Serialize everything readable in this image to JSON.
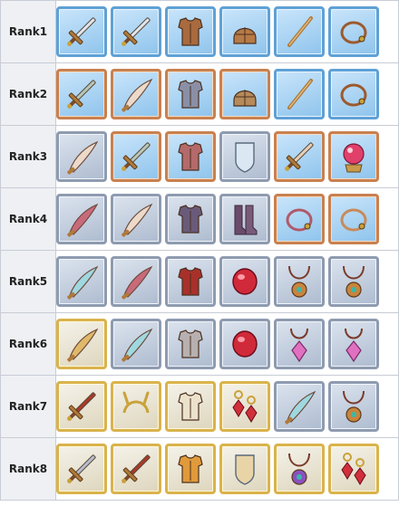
{
  "colors": {
    "blue": "#5fa1d6",
    "copper": "#c88150",
    "silver": "#8e9bb0",
    "gold": "#d9b34c"
  },
  "ranks": [
    {
      "label": "Rank1",
      "items": [
        {
          "icon": "longsword-icon",
          "frame": "blue"
        },
        {
          "icon": "longsword-icon",
          "frame": "blue"
        },
        {
          "icon": "leather-armor-icon",
          "frame": "blue"
        },
        {
          "icon": "leather-cap-icon",
          "frame": "blue"
        },
        {
          "icon": "wand-icon",
          "frame": "blue"
        },
        {
          "icon": "cord-bracelet-icon",
          "frame": "blue"
        }
      ]
    },
    {
      "label": "Rank2",
      "items": [
        {
          "icon": "spiked-sword-icon",
          "frame": "copper"
        },
        {
          "icon": "curved-blade-icon",
          "frame": "copper"
        },
        {
          "icon": "chest-armor-icon",
          "frame": "copper"
        },
        {
          "icon": "plumed-helmet-icon",
          "frame": "copper"
        },
        {
          "icon": "wand-icon",
          "frame": "blue"
        },
        {
          "icon": "cord-bracelet-icon",
          "frame": "blue"
        }
      ]
    },
    {
      "label": "Rank3",
      "items": [
        {
          "icon": "curved-blade-icon",
          "frame": "silver"
        },
        {
          "icon": "spiked-sword-icon",
          "frame": "copper"
        },
        {
          "icon": "plate-armor-icon",
          "frame": "copper"
        },
        {
          "icon": "crystal-shield-icon",
          "frame": "silver"
        },
        {
          "icon": "jeweled-dagger-icon",
          "frame": "copper"
        },
        {
          "icon": "crystal-orb-icon",
          "frame": "copper"
        }
      ]
    },
    {
      "label": "Rank4",
      "items": [
        {
          "icon": "winged-blade-icon",
          "frame": "silver"
        },
        {
          "icon": "curved-blade-icon",
          "frame": "silver"
        },
        {
          "icon": "dark-armor-icon",
          "frame": "silver"
        },
        {
          "icon": "boots-icon",
          "frame": "silver"
        },
        {
          "icon": "gem-bracelet-icon",
          "frame": "copper"
        },
        {
          "icon": "bead-bracelet-icon",
          "frame": "copper"
        }
      ]
    },
    {
      "label": "Rank5",
      "items": [
        {
          "icon": "teal-blade-icon",
          "frame": "silver"
        },
        {
          "icon": "winged-blade-icon",
          "frame": "silver"
        },
        {
          "icon": "caped-armor-icon",
          "frame": "silver"
        },
        {
          "icon": "ruby-gem-icon",
          "frame": "silver"
        },
        {
          "icon": "pendant-icon",
          "frame": "silver"
        },
        {
          "icon": "pendant-icon",
          "frame": "silver"
        }
      ]
    },
    {
      "label": "Rank6",
      "items": [
        {
          "icon": "golden-blade-icon",
          "frame": "gold"
        },
        {
          "icon": "teal-blade-icon",
          "frame": "silver"
        },
        {
          "icon": "steel-armor-icon",
          "frame": "silver"
        },
        {
          "icon": "ruby-gem-icon",
          "frame": "silver"
        },
        {
          "icon": "crystal-pendant-icon",
          "frame": "silver"
        },
        {
          "icon": "crystal-pendant-icon",
          "frame": "silver"
        }
      ]
    },
    {
      "label": "Rank7",
      "items": [
        {
          "icon": "crimson-sword-icon",
          "frame": "gold"
        },
        {
          "icon": "horned-circlet-icon",
          "frame": "gold"
        },
        {
          "icon": "ivory-armor-icon",
          "frame": "gold"
        },
        {
          "icon": "ruby-earrings-icon",
          "frame": "gold"
        },
        {
          "icon": "teal-blade-icon",
          "frame": "silver"
        },
        {
          "icon": "pendant-icon",
          "frame": "silver"
        }
      ]
    },
    {
      "label": "Rank8",
      "items": [
        {
          "icon": "serrated-sword-icon",
          "frame": "gold"
        },
        {
          "icon": "crimson-sword-icon",
          "frame": "gold"
        },
        {
          "icon": "gold-armor-icon",
          "frame": "gold"
        },
        {
          "icon": "gold-shield-icon",
          "frame": "gold"
        },
        {
          "icon": "amethyst-amulet-icon",
          "frame": "gold"
        },
        {
          "icon": "ruby-earrings-icon",
          "frame": "gold"
        }
      ]
    }
  ]
}
